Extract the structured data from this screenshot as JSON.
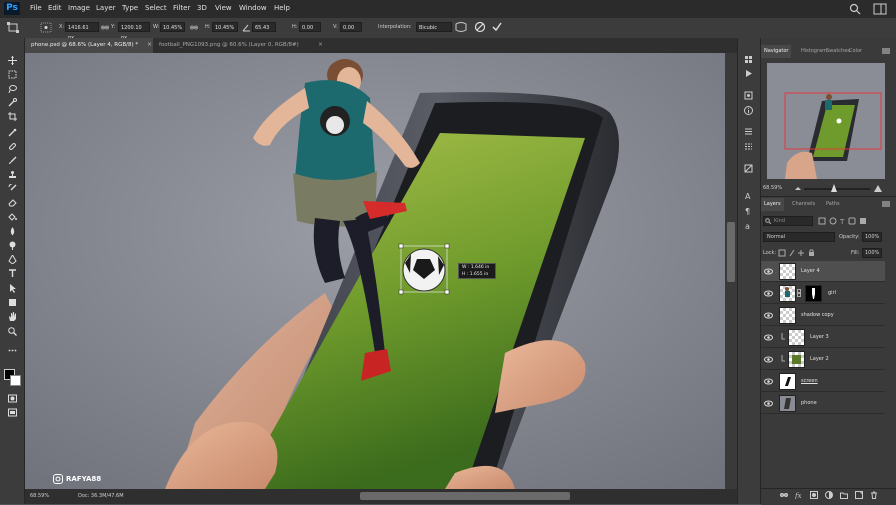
{
  "app": {
    "logo": "Ps"
  },
  "menu": [
    "File",
    "Edit",
    "Image",
    "Layer",
    "Type",
    "Select",
    "Filter",
    "3D",
    "View",
    "Window",
    "Help"
  ],
  "options": {
    "x_label": "X:",
    "x_value": "1416.61 px",
    "y_label": "Y:",
    "y_value": "1200.10 px",
    "w_label": "W:",
    "w_value": "10.45%",
    "h_label": "H:",
    "h_value": "10.45%",
    "angle_value": "65.43",
    "hskew_label": "H:",
    "hskew_value": "0.00",
    "vskew_label": "V:",
    "vskew_value": "0.00",
    "interp_label": "Interpolation:",
    "interp_value": "Bicubic"
  },
  "tabs": [
    {
      "label": "phone.psd @ 68.6% (Layer 4, RGB/8) *"
    },
    {
      "label": "football_PNG1093.png @ 60.6% (Layer 0, RGB/8#)"
    }
  ],
  "canvas": {
    "transform_w": "W : 1.646 in",
    "transform_h": "H : 1.655 in",
    "watermark": "RAFYA88"
  },
  "status": {
    "zoom": "68.59%",
    "doc": "Doc: 36.3M/47.6M"
  },
  "navigator": {
    "tabs": [
      "Navigator",
      "Histogram",
      "Swatches",
      "Color"
    ],
    "zoom": "68.59%"
  },
  "layers_panel": {
    "tabs": [
      "Layers",
      "Channels",
      "Paths"
    ],
    "kind_placeholder": "Kind",
    "blend_mode": "Normal",
    "opacity_label": "Opacity:",
    "opacity_value": "100%",
    "lock_label": "Lock:",
    "fill_label": "Fill:",
    "fill_value": "100%",
    "layers": [
      {
        "name": "Layer 4",
        "selected": true
      },
      {
        "name": "girl"
      },
      {
        "name": "shadow copy"
      },
      {
        "name": "Layer 3"
      },
      {
        "name": "Layer 2"
      },
      {
        "name": "screen"
      },
      {
        "name": "phone"
      }
    ]
  },
  "colors": {
    "accent": "#2fa3ff",
    "selection_box": "#e0383a"
  }
}
